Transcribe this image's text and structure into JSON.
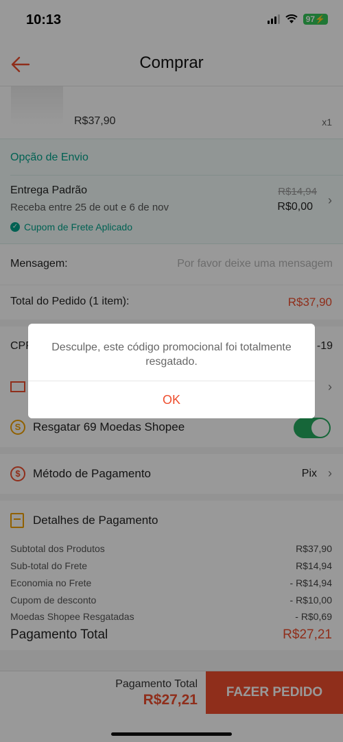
{
  "status_bar": {
    "time": "10:13",
    "battery": "97"
  },
  "nav": {
    "title": "Comprar"
  },
  "product": {
    "price": "R$37,90",
    "qty": "x1"
  },
  "shipping": {
    "header": "Opção de Envio",
    "method": "Entrega Padrão",
    "dates": "Receba entre 25 de out e 6 de nov",
    "coupon": "Cupom de Frete Aplicado",
    "old_price": "R$14,94",
    "new_price": "R$0,00"
  },
  "message": {
    "label": "Mensagem:",
    "placeholder": "Por favor deixe uma mensagem"
  },
  "order_total": {
    "label": "Total do Pedido (1 item):",
    "value": "R$37,90"
  },
  "cpf": {
    "label": "CPF",
    "value": "-19"
  },
  "coins": {
    "label": "Resgatar 69 Moedas Shopee",
    "enabled": true
  },
  "payment_method": {
    "label": "Método de Pagamento",
    "value": "Pix"
  },
  "payment_details": {
    "title": "Detalhes de Pagamento",
    "lines": [
      {
        "label": "Subtotal dos Produtos",
        "value": "R$37,90"
      },
      {
        "label": "Sub-total do Frete",
        "value": "R$14,94"
      },
      {
        "label": "Economia no Frete",
        "value": "- R$14,94"
      },
      {
        "label": "Cupom de desconto",
        "value": "- R$10,00"
      },
      {
        "label": "Moedas Shopee Resgatadas",
        "value": "- R$0,69"
      }
    ],
    "grand_label": "Pagamento Total",
    "grand_value": "R$27,21"
  },
  "bottom": {
    "total_label": "Pagamento Total",
    "total_value": "R$27,21",
    "button": "FAZER PEDIDO"
  },
  "dialog": {
    "message": "Desculpe, este código promocional foi totalmente resgatado.",
    "ok": "OK"
  },
  "colors": {
    "accent": "#ee4d2d",
    "teal": "#00a28a",
    "toggle": "#26aa5f"
  }
}
